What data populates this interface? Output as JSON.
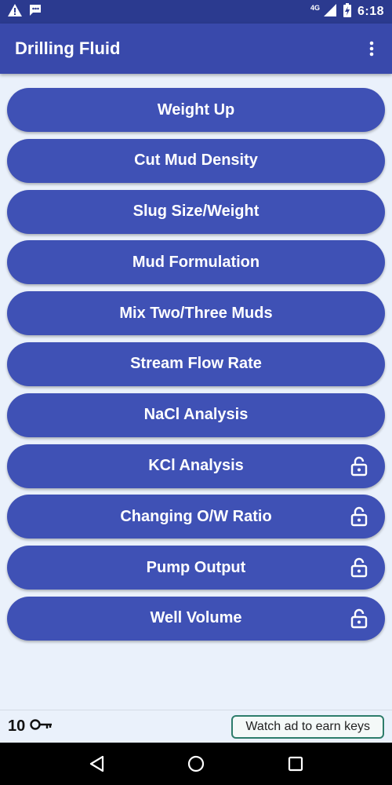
{
  "status_bar": {
    "time": "6:18",
    "network": "4G"
  },
  "app_bar": {
    "title": "Drilling Fluid"
  },
  "menu": {
    "items": [
      {
        "label": "Weight Up",
        "locked": false
      },
      {
        "label": "Cut Mud Density",
        "locked": false
      },
      {
        "label": "Slug Size/Weight",
        "locked": false
      },
      {
        "label": "Mud Formulation",
        "locked": false
      },
      {
        "label": "Mix Two/Three Muds",
        "locked": false
      },
      {
        "label": "Stream Flow Rate",
        "locked": false
      },
      {
        "label": "NaCl Analysis",
        "locked": false
      },
      {
        "label": "KCl Analysis",
        "locked": true
      },
      {
        "label": "Changing O/W Ratio",
        "locked": true
      },
      {
        "label": "Pump Output",
        "locked": true
      },
      {
        "label": "Well Volume",
        "locked": true
      }
    ]
  },
  "footer": {
    "key_count": "10",
    "watch_ad_label": "Watch ad to earn keys"
  },
  "colors": {
    "primary": "#3f51b5",
    "app_bar": "#3949ab",
    "status_bar": "#2b3a8f",
    "background": "#eaf1fb",
    "ad_border": "#2e7d6b"
  },
  "icons": {
    "status_left": [
      "warning-icon",
      "chat-icon"
    ],
    "status_right": [
      "signal-icon",
      "battery-icon"
    ],
    "lock": "lock-icon",
    "key": "key-icon",
    "nav": [
      "back-icon",
      "home-icon",
      "recents-icon"
    ]
  }
}
